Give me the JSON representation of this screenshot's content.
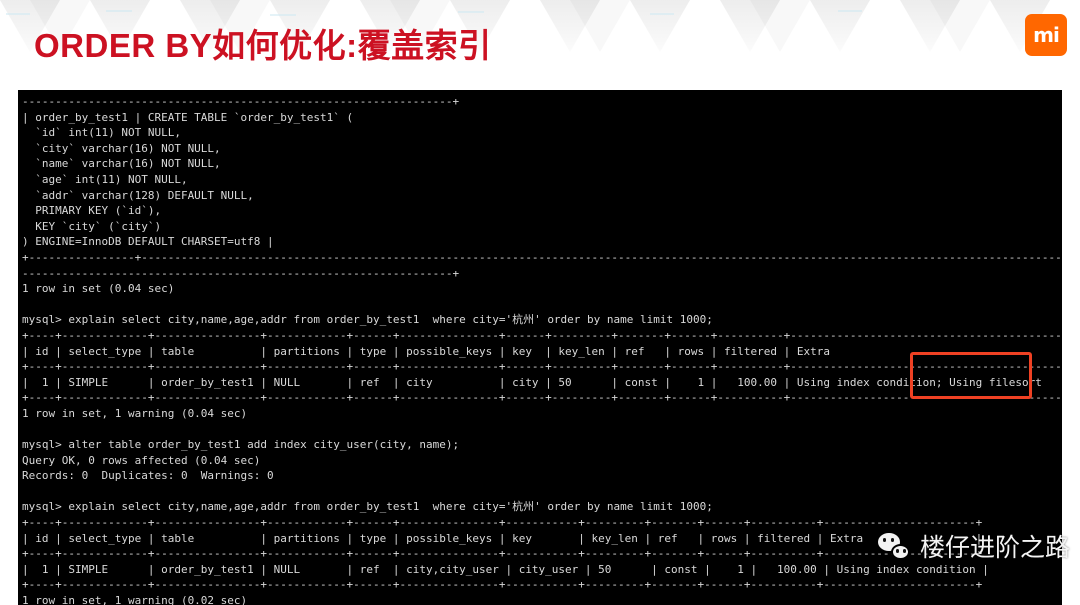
{
  "slide": {
    "title": "ORDER BY如何优化:覆盖索引",
    "title_color": "#cc1122",
    "background_color": "#ffffff"
  },
  "logo": {
    "name": "xiaomi-logo",
    "glyph": "mi",
    "color": "#ff6700"
  },
  "watermark": {
    "text": "楼仔进阶之路",
    "icon": "wechat-icon"
  },
  "highlight": {
    "name": "using-filesort-highlight",
    "color": "#ef4123",
    "target_text": "; Using filesort |"
  },
  "terminal": {
    "background": "#000000",
    "foreground": "#d9d9d9",
    "lines": [
      "-----------------------------------------------------------------+",
      "| order_by_test1 | CREATE TABLE `order_by_test1` (",
      "  `id` int(11) NOT NULL,",
      "  `city` varchar(16) NOT NULL,",
      "  `name` varchar(16) NOT NULL,",
      "  `age` int(11) NOT NULL,",
      "  `addr` varchar(128) DEFAULT NULL,",
      "  PRIMARY KEY (`id`),",
      "  KEY `city` (`city`)",
      ") ENGINE=InnoDB DEFAULT CHARSET=utf8 |",
      "+----------------+-------------------------------------------------------------------------------------------------------------------------------------------------------",
      "-----------------------------------------------------------------+",
      "1 row in set (0.04 sec)",
      "",
      "mysql> explain select city,name,age,addr from order_by_test1  where city='杭州' order by name limit 1000;",
      "+----+-------------+----------------+------------+------+---------------+------+---------+-------+------+----------+------------------------------------------+",
      "| id | select_type | table          | partitions | type | possible_keys | key  | key_len | ref   | rows | filtered | Extra                                    |",
      "+----+-------------+----------------+------------+------+---------------+------+---------+-------+------+----------+------------------------------------------+",
      "|  1 | SIMPLE      | order_by_test1 | NULL       | ref  | city          | city | 50      | const |    1 |   100.00 | Using index condition; Using filesort    |",
      "+----+-------------+----------------+------------+------+---------------+------+---------+-------+------+----------+------------------------------------------+",
      "1 row in set, 1 warning (0.04 sec)",
      "",
      "mysql> alter table order_by_test1 add index city_user(city, name);",
      "Query OK, 0 rows affected (0.04 sec)",
      "Records: 0  Duplicates: 0  Warnings: 0",
      "",
      "mysql> explain select city,name,age,addr from order_by_test1  where city='杭州' order by name limit 1000;",
      "+----+-------------+----------------+------------+------+---------------+-----------+---------+-------+------+----------+-----------------------+",
      "| id | select_type | table          | partitions | type | possible_keys | key       | key_len | ref   | rows | filtered | Extra                 |",
      "+----+-------------+----------------+------------+------+---------------+-----------+---------+-------+------+----------+-----------------------+",
      "|  1 | SIMPLE      | order_by_test1 | NULL       | ref  | city,city_user | city_user | 50      | const |    1 |   100.00 | Using index condition |",
      "+----+-------------+----------------+------------+------+---------------+-----------+---------+-------+------+----------+-----------------------+",
      "1 row in set, 1 warning (0.02 sec)"
    ]
  }
}
